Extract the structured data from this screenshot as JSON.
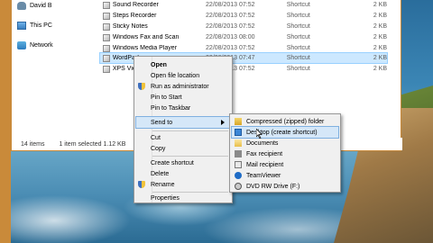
{
  "nav": {
    "user": "David B",
    "this_pc": "This PC",
    "network": "Network"
  },
  "files": [
    {
      "name": "Sound Recorder",
      "date": "22/08/2013 07:52",
      "type": "Shortcut",
      "size": "2 KB"
    },
    {
      "name": "Steps Recorder",
      "date": "22/08/2013 07:52",
      "type": "Shortcut",
      "size": "2 KB"
    },
    {
      "name": "Sticky Notes",
      "date": "22/08/2013 07:52",
      "type": "Shortcut",
      "size": "2 KB"
    },
    {
      "name": "Windows Fax and Scan",
      "date": "22/08/2013 08:00",
      "type": "Shortcut",
      "size": "2 KB"
    },
    {
      "name": "Windows Media Player",
      "date": "22/08/2013 07:52",
      "type": "Shortcut",
      "size": "2 KB"
    },
    {
      "name": "WordPad",
      "date": "22/08/2013 07:47",
      "type": "Shortcut",
      "size": "2 KB"
    },
    {
      "name": "XPS View",
      "date": "22/08/2013 07:52",
      "type": "Shortcut",
      "size": "2 KB"
    }
  ],
  "status": {
    "items": "14 items",
    "selected": "1 item selected  1.12 KB"
  },
  "context_menu": {
    "open": "Open",
    "open_location": "Open file location",
    "run_admin": "Run as administrator",
    "pin_start": "Pin to Start",
    "pin_taskbar": "Pin to Taskbar",
    "send_to": "Send to",
    "cut": "Cut",
    "copy": "Copy",
    "create_shortcut": "Create shortcut",
    "delete": "Delete",
    "rename": "Rename",
    "properties": "Properties"
  },
  "send_to_menu": {
    "zip": "Compressed (zipped) folder",
    "desktop": "Desktop (create shortcut)",
    "documents": "Documents",
    "fax": "Fax recipient",
    "mail": "Mail recipient",
    "teamviewer": "TeamViewer",
    "dvd": "DVD RW Drive (F:)"
  }
}
